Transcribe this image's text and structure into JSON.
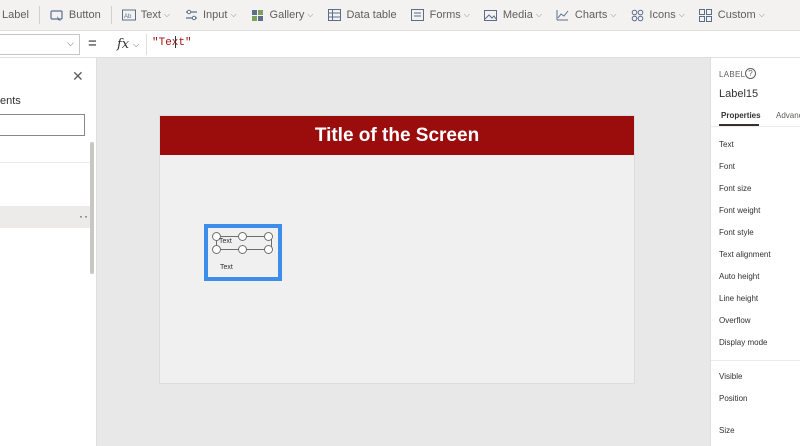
{
  "toolbar": {
    "items": [
      {
        "label": "Label",
        "icon": "label-icon"
      },
      {
        "label": "Button",
        "icon": "button-icon"
      },
      {
        "label": "Text",
        "icon": "text-icon",
        "dropdown": true
      },
      {
        "label": "Input",
        "icon": "input-icon",
        "dropdown": true
      },
      {
        "label": "Gallery",
        "icon": "gallery-icon",
        "dropdown": true
      },
      {
        "label": "Data table",
        "icon": "data-table-icon"
      },
      {
        "label": "Forms",
        "icon": "forms-icon",
        "dropdown": true
      },
      {
        "label": "Media",
        "icon": "media-icon",
        "dropdown": true
      },
      {
        "label": "Charts",
        "icon": "charts-icon",
        "dropdown": true
      },
      {
        "label": "Icons",
        "icon": "icons-icon",
        "dropdown": true
      },
      {
        "label": "Custom",
        "icon": "custom-icon",
        "dropdown": true
      }
    ]
  },
  "formula_bar": {
    "equals": "=",
    "fx": "fx",
    "formula": "\"Text\""
  },
  "tree_panel": {
    "title_fragment": "ents",
    "more": "···"
  },
  "canvas": {
    "screen_title": "Title of the Screen",
    "selected_label_text": "Text",
    "second_label_text": "Text",
    "header_color": "#9b0d0d",
    "selection_color": "#3d8eea"
  },
  "properties_panel": {
    "control_type": "LABEL",
    "control_name": "Label15",
    "tab_properties": "Properties",
    "tab_advanced": "Advanc",
    "properties": [
      "Text",
      "Font",
      "Font size",
      "Font weight",
      "Font style",
      "Text alignment",
      "Auto height",
      "Line height",
      "Overflow",
      "Display mode"
    ],
    "properties_2": [
      "Visible",
      "Position",
      "Size"
    ]
  }
}
